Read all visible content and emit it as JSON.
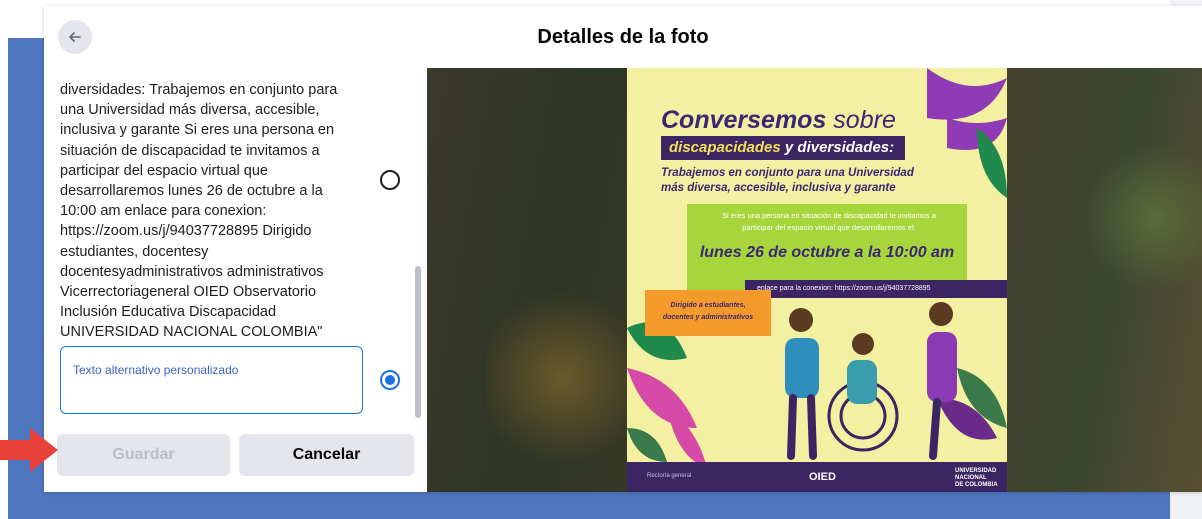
{
  "dialog": {
    "title": "Detalles de la foto",
    "back_icon": "arrow-left-icon"
  },
  "left_panel": {
    "description": "diversidades: Trabajemos en conjunto para\nuna Universidad más diversa, accesible,\ninclusiva y garante Si eres una persona en\nsituación de discapacidad te invitamos a\nparticipar del espacio virtual que\ndesarrollaremos lunes 26 de octubre a la\n10:00 am enlace para conexion:\nhttps://zoom.us/j/94037728895 Dirigido\nestudiantes, docentesy\ndocentesyadministrativos administrativos\nVicerrectoriageneral OIED Observatorio\nInclusión Educativa Discapacidad\nUNIVERSIDAD NACIONAL COLOMBIA\"",
    "alt_text_placeholder": "Texto alternativo personalizado",
    "alt_text_value": "",
    "save_label": "Guardar",
    "cancel_label": "Cancelar",
    "radio_auto_selected": false,
    "radio_custom_selected": true
  },
  "poster": {
    "title_bold": "Conversemos",
    "title_light": " sobre",
    "band_yellow": "discapacidades",
    "band_white": " y diversidades:",
    "subtitle": "Trabajemos en conjunto para una Universidad\nmás diversa, accesible, inclusiva y garante",
    "green_text": "Si eres una persona en situación de discapacidad te invitamos a\nparticipar del espacio virtual que desarrollaremos el:",
    "date_text": "lunes 26 de octubre a la 10:00 am",
    "link_text": "enlace para la conexion: https://zoom.us/j/94037728895",
    "orange_text": "Dirigido a estudiantes,\ndocentes y administrativos",
    "footer_left": "Rectoría general",
    "footer_logo": "OIED",
    "footer_unal": "UNIVERSIDAD\nNACIONAL\nDE COLOMBIA"
  },
  "colors": {
    "accent": "#1b74e4",
    "background_blue": "#4f76c0",
    "arrow_red": "#e8413b",
    "poster_purple": "#3b2562",
    "poster_green": "#a6d63c",
    "poster_orange": "#f39a2b"
  }
}
